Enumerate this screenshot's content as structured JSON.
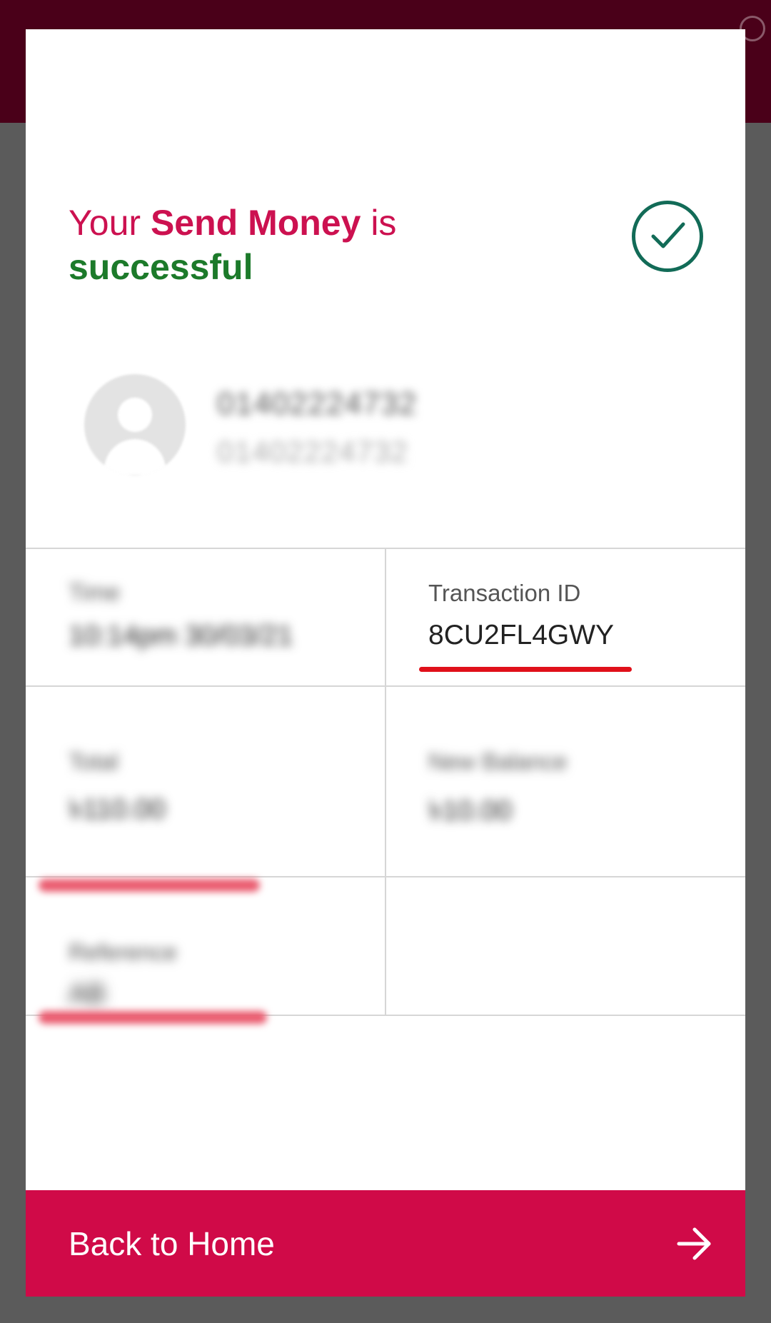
{
  "headline": {
    "prefix": "Your",
    "action": "Send Money",
    "middle": "is",
    "status": "successful"
  },
  "recipient": {
    "name": "01402224732",
    "number": "01402224732"
  },
  "details": {
    "time": {
      "label": "Time",
      "value": "10:14pm 30/03/21"
    },
    "transaction": {
      "label": "Transaction ID",
      "value": "8CU2FL4GWY"
    },
    "total": {
      "label": "Total",
      "value": "৳110.00"
    },
    "new_balance": {
      "label": "New Balance",
      "value": "৳10.00"
    },
    "reference": {
      "label": "Reference",
      "value": "AB"
    }
  },
  "footer": {
    "back_label": "Back to Home"
  },
  "colors": {
    "brand": "#d00a48",
    "success": "#1c7a2a",
    "check": "#126b57",
    "topbar": "#4a0019"
  },
  "icons": {
    "check": "check-circle-icon",
    "avatar": "user-avatar-icon",
    "arrow": "arrow-right-icon"
  }
}
